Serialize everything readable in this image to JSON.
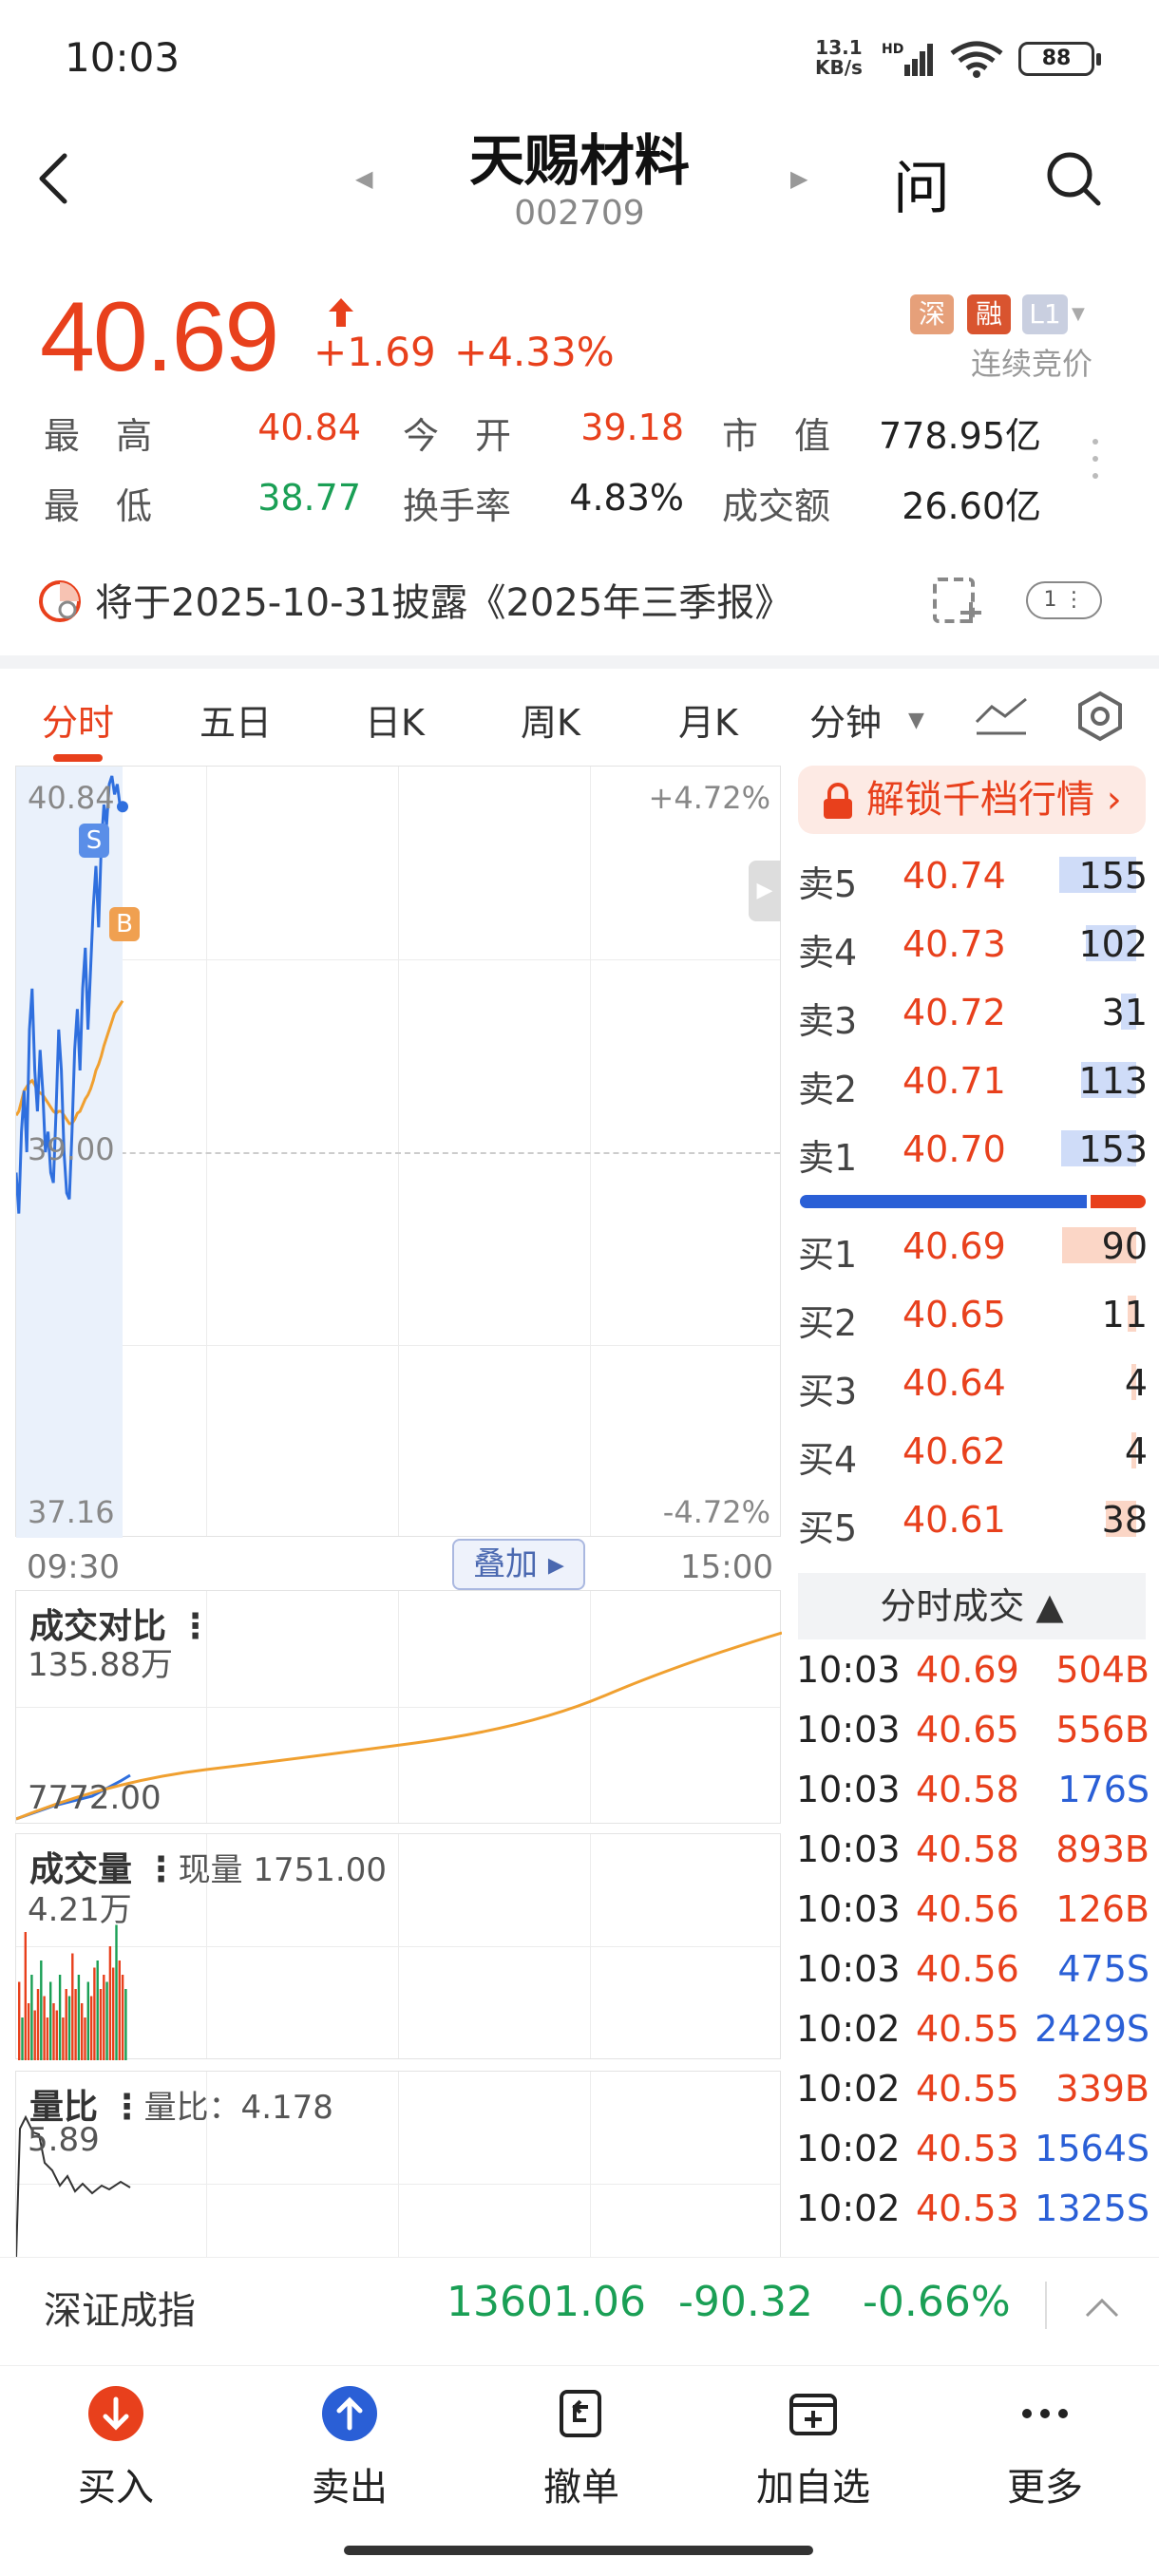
{
  "status_bar": {
    "time": "10:03",
    "net_speed": "13.1",
    "net_unit": "KB/s",
    "net_type": "HD",
    "battery": "88"
  },
  "header": {
    "name": "天赐材料",
    "code": "002709",
    "ask_label": "问"
  },
  "quote": {
    "price": "40.69",
    "change": "+1.69",
    "change_pct": "+4.33%",
    "badges": [
      "深",
      "融",
      "L1"
    ],
    "auction_status": "连续竞价",
    "stats": [
      {
        "label": "最　高",
        "value": "40.84",
        "color": "red"
      },
      {
        "label": "今　开",
        "value": "39.18",
        "color": "red"
      },
      {
        "label": "市　值",
        "value": "778.95亿",
        "color": "black"
      },
      {
        "label": "最　低",
        "value": "38.77",
        "color": "green"
      },
      {
        "label": "换手率",
        "value": "4.83%",
        "color": "black"
      },
      {
        "label": "成交额",
        "value": "26.60亿",
        "color": "black"
      }
    ]
  },
  "notice": {
    "text": "将于2025-10-31披露《2025年三季报》",
    "toggle": "1"
  },
  "tabs": [
    "分时",
    "五日",
    "日K",
    "周K",
    "月K",
    "分钟"
  ],
  "main_chart": {
    "y_top": "40.84",
    "y_mid": "39.00",
    "y_bottom": "37.16",
    "pct_top": "+4.72%",
    "pct_bottom": "-4.72%",
    "time_start": "09:30",
    "time_end": "15:00",
    "overlay_label": "叠加",
    "sell_marker": "S",
    "buy_marker": "B",
    "ylim": [
      37.16,
      40.84
    ],
    "price_series": [
      38.9,
      38.7,
      39.1,
      39.3,
      39.0,
      39.6,
      39.8,
      39.4,
      39.2,
      39.5,
      39.3,
      39.0,
      39.1,
      38.9,
      38.85,
      39.2,
      39.6,
      39.4,
      39.0,
      38.8,
      38.77,
      39.1,
      39.5,
      39.7,
      39.4,
      39.8,
      40.0,
      39.6,
      39.9,
      40.2,
      40.4,
      40.1,
      40.5,
      40.7,
      40.6,
      40.8,
      40.84,
      40.75,
      40.8,
      40.7,
      40.69
    ],
    "avg_series": [
      39.18,
      39.2,
      39.25,
      39.3,
      39.32,
      39.34,
      39.35,
      39.33,
      39.3,
      39.29,
      39.28,
      39.26,
      39.24,
      39.22,
      39.2,
      39.19,
      39.2,
      39.2,
      39.18,
      39.16,
      39.14,
      39.14,
      39.16,
      39.19,
      39.2,
      39.23,
      39.26,
      39.28,
      39.31,
      39.35,
      39.4,
      39.43,
      39.47,
      39.52,
      39.56,
      39.6,
      39.64,
      39.68,
      39.7,
      39.72,
      39.74
    ]
  },
  "sub_charts": {
    "compare": {
      "title": "成交对比",
      "top": "135.88万",
      "bottom": "7772.00"
    },
    "volume": {
      "title": "成交量",
      "current": "现量 1751.00",
      "max": "4.21万"
    },
    "vol_ratio": {
      "title": "量比",
      "current": "量比：4.178",
      "max": "5.89"
    }
  },
  "order_book": {
    "unlock_label": "解锁千档行情",
    "asks": [
      {
        "label": "卖5",
        "price": "40.74",
        "vol": "155",
        "fill": 0.62
      },
      {
        "label": "卖4",
        "price": "40.73",
        "vol": "102",
        "fill": 0.41
      },
      {
        "label": "卖3",
        "price": "40.72",
        "vol": "31",
        "fill": 0.12
      },
      {
        "label": "卖2",
        "price": "40.71",
        "vol": "113",
        "fill": 0.45
      },
      {
        "label": "卖1",
        "price": "40.70",
        "vol": "153",
        "fill": 0.61
      }
    ],
    "bids": [
      {
        "label": "买1",
        "price": "40.69",
        "vol": "90",
        "fill": 0.6
      },
      {
        "label": "买2",
        "price": "40.65",
        "vol": "11",
        "fill": 0.07
      },
      {
        "label": "买3",
        "price": "40.64",
        "vol": "4",
        "fill": 0.03
      },
      {
        "label": "买4",
        "price": "40.62",
        "vol": "4",
        "fill": 0.03
      },
      {
        "label": "买5",
        "price": "40.61",
        "vol": "38",
        "fill": 0.25
      }
    ],
    "buy_sell_ratio": 0.84,
    "ask_color": "#cfdcf8",
    "bid_color": "#fbd6c6"
  },
  "ticks": {
    "header": "分时成交",
    "rows": [
      {
        "time": "10:03",
        "price": "40.69",
        "vol": "504B"
      },
      {
        "time": "10:03",
        "price": "40.65",
        "vol": "556B"
      },
      {
        "time": "10:03",
        "price": "40.58",
        "vol": "176S"
      },
      {
        "time": "10:03",
        "price": "40.58",
        "vol": "893B"
      },
      {
        "time": "10:03",
        "price": "40.56",
        "vol": "126B"
      },
      {
        "time": "10:03",
        "price": "40.56",
        "vol": "475S"
      },
      {
        "time": "10:02",
        "price": "40.55",
        "vol": "2429S"
      },
      {
        "time": "10:02",
        "price": "40.55",
        "vol": "339B"
      },
      {
        "time": "10:02",
        "price": "40.53",
        "vol": "1564S"
      },
      {
        "time": "10:02",
        "price": "40.53",
        "vol": "1325S"
      }
    ]
  },
  "index_bar": {
    "name": "深证成指",
    "value": "13601.06",
    "change": "-90.32",
    "change_pct": "-0.66%"
  },
  "bottom_nav": [
    {
      "label": "买入",
      "icon": "buy-arrow-down-icon"
    },
    {
      "label": "卖出",
      "icon": "sell-arrow-up-icon"
    },
    {
      "label": "撤单",
      "icon": "cancel-order-icon"
    },
    {
      "label": "加自选",
      "icon": "add-watchlist-icon"
    },
    {
      "label": "更多",
      "icon": "more-dots-icon"
    }
  ],
  "colors": {
    "up": "#e8401c",
    "down": "#1a9f55",
    "blue": "#2a5fd6",
    "price_line": "#2f6fde",
    "avg_line": "#f0a030"
  }
}
